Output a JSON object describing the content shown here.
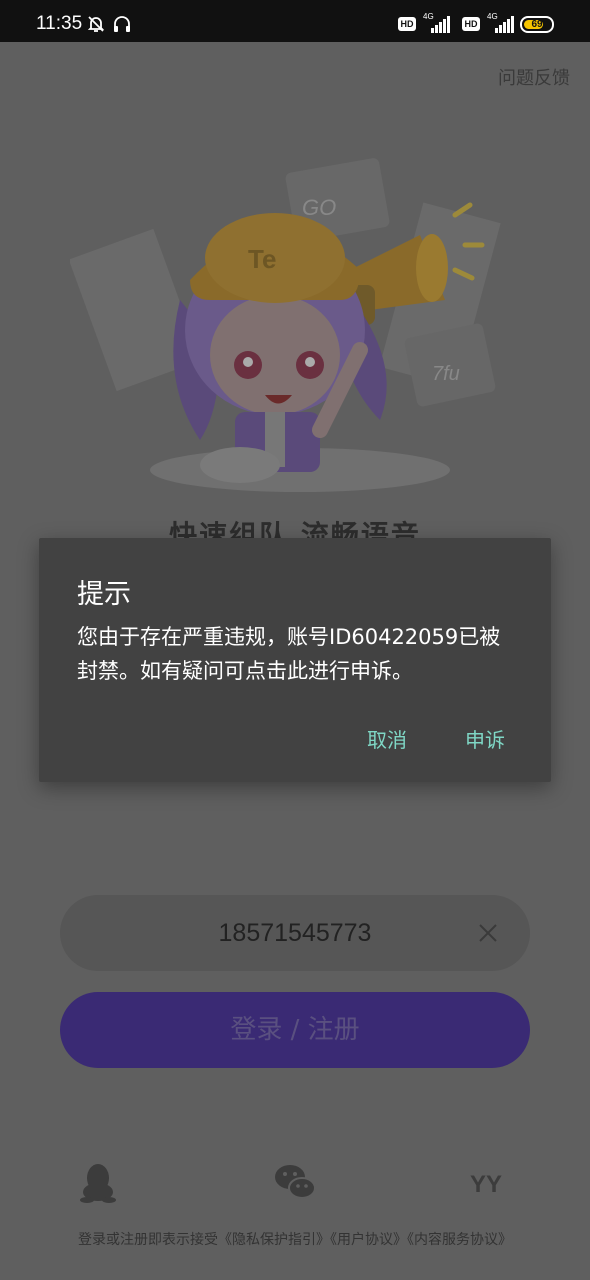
{
  "status_bar": {
    "time": "11:35",
    "network1": "4G",
    "network2": "4G",
    "hd1": "HD",
    "hd2": "HD",
    "battery": "69",
    "icons": [
      "bell-off-icon",
      "headset-icon",
      "hd-icon",
      "signal-icon",
      "battery-icon"
    ]
  },
  "header": {
    "feedback_label": "问题反馈"
  },
  "hero": {
    "badge1": "GO",
    "badge2": "7fu"
  },
  "slogan": "快速组队 流畅语音",
  "phone": {
    "value": "18571545773",
    "clear_icon": "close-icon"
  },
  "login": {
    "label": "登录 / 注册"
  },
  "social": {
    "icons": [
      "qq-icon",
      "wechat-icon",
      "yy-icon"
    ],
    "yy_label": "YY"
  },
  "terms": "登录或注册即表示接受《隐私保护指引》《用户协议》《内容服务协议》",
  "dialog": {
    "title": "提示",
    "message": "您由于存在严重违规，账号ID60422059已被封禁。如有疑问可点击此进行申诉。",
    "cancel_label": "取消",
    "appeal_label": "申诉"
  },
  "colors": {
    "dialog_bg": "#424242",
    "dialog_action": "#7fd7c5",
    "login_button": "#3a2a74",
    "scrim_bg": "#5f5f5f"
  }
}
